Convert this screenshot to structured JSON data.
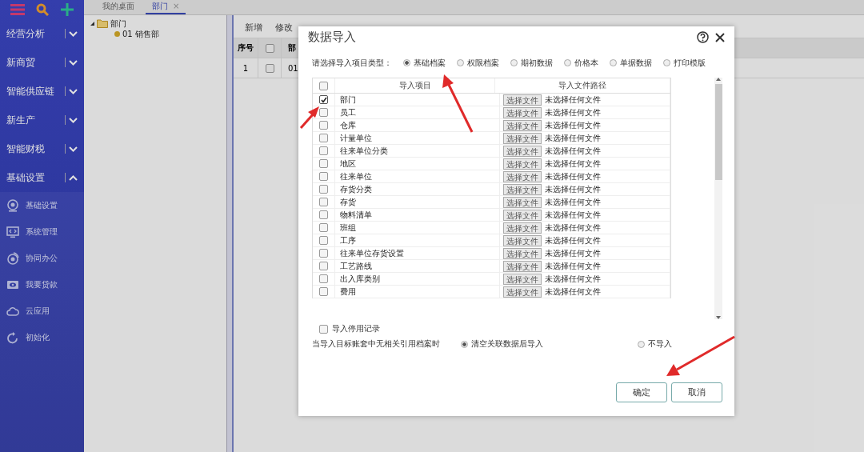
{
  "sidebar": {
    "menus": [
      {
        "label": "经营分析",
        "expanded": false
      },
      {
        "label": "新商贸",
        "expanded": false
      },
      {
        "label": "智能供应链",
        "expanded": false
      },
      {
        "label": "新生产",
        "expanded": false
      },
      {
        "label": "智能财税",
        "expanded": false
      },
      {
        "label": "基础设置",
        "expanded": true
      }
    ],
    "submenu": [
      "基础设置",
      "系统管理",
      "协同办公",
      "我要贷款",
      "云应用",
      "初始化"
    ]
  },
  "tabs": [
    {
      "label": "我的桌面",
      "selected": false
    },
    {
      "label": "部门",
      "selected": true,
      "close": "×"
    }
  ],
  "tree": {
    "label": "部门",
    "expanded": true,
    "children": [
      {
        "label": "01 销售部"
      }
    ]
  },
  "toolbar": [
    "新增",
    "修改"
  ],
  "table": {
    "columns": [
      "序号",
      "部"
    ],
    "all_checked": false,
    "rows": [
      {
        "index": "1",
        "checked": false,
        "code": "01"
      }
    ]
  },
  "dialog": {
    "title": "数据导入",
    "type_prompt": "请选择导入项目类型：",
    "types": [
      {
        "label": "基础档案",
        "selected": true
      },
      {
        "label": "权限档案",
        "selected": false
      },
      {
        "label": "期初数据",
        "selected": false
      },
      {
        "label": "价格本",
        "selected": false
      },
      {
        "label": "单据数据",
        "selected": false
      },
      {
        "label": "打印模版",
        "selected": false
      }
    ],
    "columns": [
      "导入项目",
      "导入文件路径"
    ],
    "all_checked": false,
    "items": [
      {
        "name": "部门",
        "checked": true,
        "button": "选择文件",
        "file": "未选择任何文件"
      },
      {
        "name": "员工",
        "checked": false,
        "button": "选择文件",
        "file": "未选择任何文件"
      },
      {
        "name": "仓库",
        "checked": false,
        "button": "选择文件",
        "file": "未选择任何文件"
      },
      {
        "name": "计量单位",
        "checked": false,
        "button": "选择文件",
        "file": "未选择任何文件"
      },
      {
        "name": "往来单位分类",
        "checked": false,
        "button": "选择文件",
        "file": "未选择任何文件"
      },
      {
        "name": "地区",
        "checked": false,
        "button": "选择文件",
        "file": "未选择任何文件"
      },
      {
        "name": "往来单位",
        "checked": false,
        "button": "选择文件",
        "file": "未选择任何文件"
      },
      {
        "name": "存货分类",
        "checked": false,
        "button": "选择文件",
        "file": "未选择任何文件"
      },
      {
        "name": "存货",
        "checked": false,
        "button": "选择文件",
        "file": "未选择任何文件"
      },
      {
        "name": "物料清单",
        "checked": false,
        "button": "选择文件",
        "file": "未选择任何文件"
      },
      {
        "name": "班组",
        "checked": false,
        "button": "选择文件",
        "file": "未选择任何文件"
      },
      {
        "name": "工序",
        "checked": false,
        "button": "选择文件",
        "file": "未选择任何文件"
      },
      {
        "name": "往来单位存货设置",
        "checked": false,
        "button": "选择文件",
        "file": "未选择任何文件"
      },
      {
        "name": "工艺路线",
        "checked": false,
        "button": "选择文件",
        "file": "未选择任何文件"
      },
      {
        "name": "出入库类别",
        "checked": false,
        "button": "选择文件",
        "file": "未选择任何文件"
      },
      {
        "name": "费用",
        "checked": false,
        "button": "选择文件",
        "file": "未选择任何文件"
      }
    ],
    "import_disabled": {
      "label": "导入停用记录",
      "checked": false
    },
    "ref_prompt": "当导入目标账套中无相关引用档案时",
    "ref_options": [
      {
        "label": "清空关联数据后导入",
        "selected": true
      },
      {
        "label": "不导入",
        "selected": false
      }
    ],
    "buttons": [
      "确定",
      "取消"
    ]
  }
}
